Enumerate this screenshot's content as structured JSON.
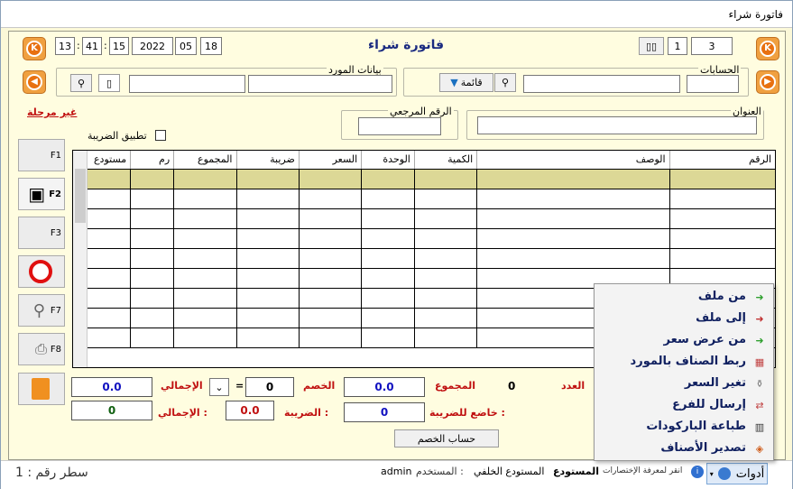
{
  "window": {
    "title": "فاتورة شراء"
  },
  "header": {
    "heading": "فاتورة شراء",
    "date": {
      "day": "18",
      "month": "05",
      "year": "2022"
    },
    "time": {
      "sec": "15",
      "min": "41",
      "hour": "13"
    },
    "page_num": "3",
    "page_of": "1"
  },
  "supplier": {
    "label": "بيانات المورد",
    "name": "",
    "code": ""
  },
  "accounts": {
    "label": "الحسابات",
    "name": "",
    "code": "",
    "list_button": "قائمة"
  },
  "status": {
    "unposted": "غير مرحلة",
    "apply_tax": "تطبيق الضريبة"
  },
  "address": {
    "label": "العنوان",
    "value": ""
  },
  "reference": {
    "label": "الرقم المرجعي",
    "value": ""
  },
  "fkeys": [
    "F1",
    "F2",
    "F3",
    "",
    "F7",
    "F8",
    ""
  ],
  "grid": {
    "columns": [
      "الرقم",
      "الوصف",
      "الكمية",
      "الوحدة",
      "السعر",
      "ضريبة",
      "المجموع",
      "رم",
      "مستودع"
    ],
    "rows": 9
  },
  "totals": {
    "count_label": "العدد",
    "count": "0",
    "sum_label": "المجموع",
    "sum": "0.0",
    "discount_label": "الخصم",
    "discount": "0",
    "discount_op": "=",
    "total_label": "الإجمالي",
    "total": "0.0",
    "tax_label": "الضريبة :",
    "tax": "0.0",
    "total2_label": "الإجمالي :",
    "total2": "0",
    "taxable_label": "خاضع للضريبة :",
    "taxable": "0",
    "calc_discount": "حساب الخصم"
  },
  "statusbar": {
    "line": "سطر رقم : 1",
    "user_label": "المستخدم :",
    "user": "admin",
    "warehouse_label": "المستودع",
    "warehouse": "المستودع الخلفي",
    "shortcuts": "انقر لمعرفة الإختصارات",
    "tools": "أدوات"
  },
  "menu": {
    "items": [
      "من ملف",
      "إلى ملف",
      "من عرض سعر",
      "ربط الصناف بالمورد",
      "تغير السعر",
      "إرسال للفرع",
      "طباعة الباركودات",
      "تصدير الأصناف"
    ]
  }
}
